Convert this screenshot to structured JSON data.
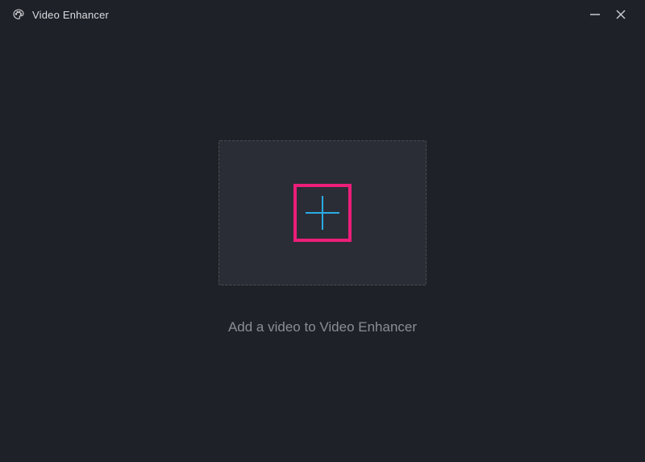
{
  "titlebar": {
    "app_title": "Video Enhancer"
  },
  "main": {
    "instruction": "Add a video to Video Enhancer"
  },
  "icons": {
    "app": "palette-icon",
    "minimize": "minimize-icon",
    "close": "close-icon",
    "add": "plus-icon"
  },
  "colors": {
    "accent_pink": "#ec1e79",
    "plus_blue": "#29abe2",
    "bg": "#1f2128",
    "dropzone_bg": "#2b2d36"
  }
}
